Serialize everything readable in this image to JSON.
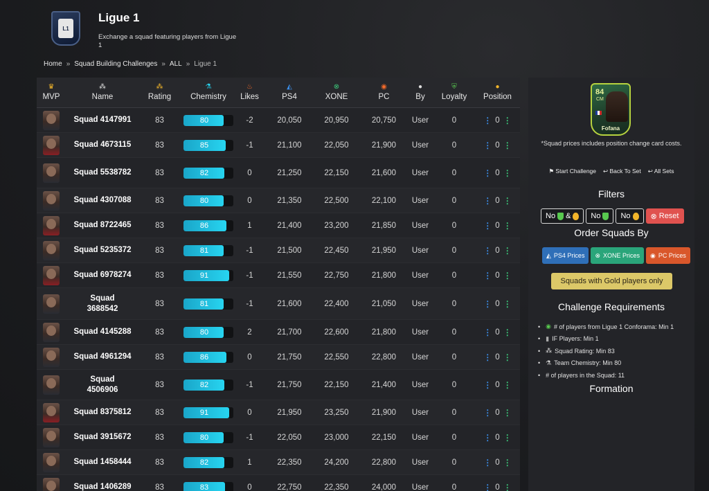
{
  "header": {
    "title": "Ligue 1",
    "subtitle": "Exchange a squad featuring players from Ligue 1",
    "logo_text": "L1"
  },
  "breadcrumb": {
    "items": [
      "Home",
      "Squad Building Challenges",
      "ALL"
    ],
    "current": "Ligue 1"
  },
  "table": {
    "columns": [
      "MVP",
      "Name",
      "Rating",
      "Chemistry",
      "Likes",
      "PS4",
      "XONE",
      "PC",
      "By",
      "Loyalty",
      "Position"
    ],
    "rows": [
      {
        "name": "Squad 4147991",
        "rating": "83",
        "chemistry": "80",
        "likes": "-2",
        "ps4": "20,050",
        "xone": "20,950",
        "pc": "20,750",
        "by": "User",
        "loyalty": "0",
        "position": "0"
      },
      {
        "name": "Squad 4673115",
        "rating": "83",
        "chemistry": "85",
        "likes": "-1",
        "ps4": "21,100",
        "xone": "22,050",
        "pc": "21,900",
        "by": "User",
        "loyalty": "0",
        "position": "0"
      },
      {
        "name": "Squad 5538782",
        "rating": "83",
        "chemistry": "82",
        "likes": "0",
        "ps4": "21,250",
        "xone": "22,150",
        "pc": "21,600",
        "by": "User",
        "loyalty": "0",
        "position": "0"
      },
      {
        "name": "Squad 4307088",
        "rating": "83",
        "chemistry": "80",
        "likes": "0",
        "ps4": "21,350",
        "xone": "22,500",
        "pc": "22,100",
        "by": "User",
        "loyalty": "0",
        "position": "0"
      },
      {
        "name": "Squad 8722465",
        "rating": "83",
        "chemistry": "86",
        "likes": "1",
        "ps4": "21,400",
        "xone": "23,200",
        "pc": "21,850",
        "by": "User",
        "loyalty": "0",
        "position": "0"
      },
      {
        "name": "Squad 5235372",
        "rating": "83",
        "chemistry": "81",
        "likes": "-1",
        "ps4": "21,500",
        "xone": "22,450",
        "pc": "21,950",
        "by": "User",
        "loyalty": "0",
        "position": "0"
      },
      {
        "name": "Squad 6978274",
        "rating": "83",
        "chemistry": "91",
        "likes": "-1",
        "ps4": "21,550",
        "xone": "22,750",
        "pc": "21,800",
        "by": "User",
        "loyalty": "0",
        "position": "0"
      },
      {
        "name": "Squad 3688542",
        "rating": "83",
        "chemistry": "81",
        "likes": "-1",
        "ps4": "21,600",
        "xone": "22,400",
        "pc": "21,050",
        "by": "User",
        "loyalty": "0",
        "position": "0"
      },
      {
        "name": "Squad 4145288",
        "rating": "83",
        "chemistry": "80",
        "likes": "2",
        "ps4": "21,700",
        "xone": "22,600",
        "pc": "21,800",
        "by": "User",
        "loyalty": "0",
        "position": "0"
      },
      {
        "name": "Squad 4961294",
        "rating": "83",
        "chemistry": "86",
        "likes": "0",
        "ps4": "21,750",
        "xone": "22,550",
        "pc": "22,800",
        "by": "User",
        "loyalty": "0",
        "position": "0"
      },
      {
        "name": "Squad 4506906",
        "rating": "83",
        "chemistry": "82",
        "likes": "-1",
        "ps4": "21,750",
        "xone": "22,150",
        "pc": "21,400",
        "by": "User",
        "loyalty": "0",
        "position": "0"
      },
      {
        "name": "Squad 8375812",
        "rating": "83",
        "chemistry": "91",
        "likes": "0",
        "ps4": "21,950",
        "xone": "23,250",
        "pc": "21,900",
        "by": "User",
        "loyalty": "0",
        "position": "0"
      },
      {
        "name": "Squad 3915672",
        "rating": "83",
        "chemistry": "80",
        "likes": "-1",
        "ps4": "22,050",
        "xone": "23,000",
        "pc": "22,150",
        "by": "User",
        "loyalty": "0",
        "position": "0"
      },
      {
        "name": "Squad 1458444",
        "rating": "83",
        "chemistry": "82",
        "likes": "1",
        "ps4": "22,350",
        "xone": "24,200",
        "pc": "22,800",
        "by": "User",
        "loyalty": "0",
        "position": "0"
      },
      {
        "name": "Squad 1406289",
        "rating": "83",
        "chemistry": "83",
        "likes": "0",
        "ps4": "22,750",
        "xone": "22,350",
        "pc": "24,000",
        "by": "User",
        "loyalty": "0",
        "position": "0"
      }
    ]
  },
  "sidebar": {
    "card": {
      "rating": "84",
      "position": "CM",
      "name": "Fofana"
    },
    "note": "*Squad prices includes position change card costs.",
    "links": [
      "Start Challenge",
      "Back To Set",
      "All Sets"
    ],
    "filters_title": "Filters",
    "filters": {
      "no_both": "No",
      "amp": "&",
      "no_loyalty": "No",
      "no_position": "No",
      "reset": "Reset"
    },
    "order_title": "Order Squads By",
    "order": [
      "PS4 Prices",
      "XONE Prices",
      "PC Prices"
    ],
    "gold_button": "Squads with Gold players only",
    "requirements_title": "Challenge Requirements",
    "requirements": [
      "# of players from Ligue 1 Conforama: Min 1",
      "IF Players: Min 1",
      "Squad Rating: Min 83",
      "Team Chemistry: Min 80",
      "# of players in the Squad: 11"
    ],
    "formation_title": "Formation"
  },
  "colors": {
    "chem_fill": "#27d4f0",
    "ps4": "#2f6fb8",
    "xone": "#2aa57a",
    "pc": "#d9572b",
    "gold": "#dcc868",
    "reset": "#e0524f",
    "position_dots_left": "#3b8ee8",
    "position_dots_right": "#3cc77a"
  },
  "icons": {
    "mvp": "trophy-icon",
    "name": "squad-formation-icon",
    "rating": "stars-icon",
    "chemistry": "flask-icon",
    "likes": "flame-icon",
    "ps4": "playstation-icon",
    "xone": "xbox-icon",
    "pc": "origin-icon",
    "by": "user-icon",
    "loyalty": "shield-icon",
    "position": "position-change-icon"
  }
}
